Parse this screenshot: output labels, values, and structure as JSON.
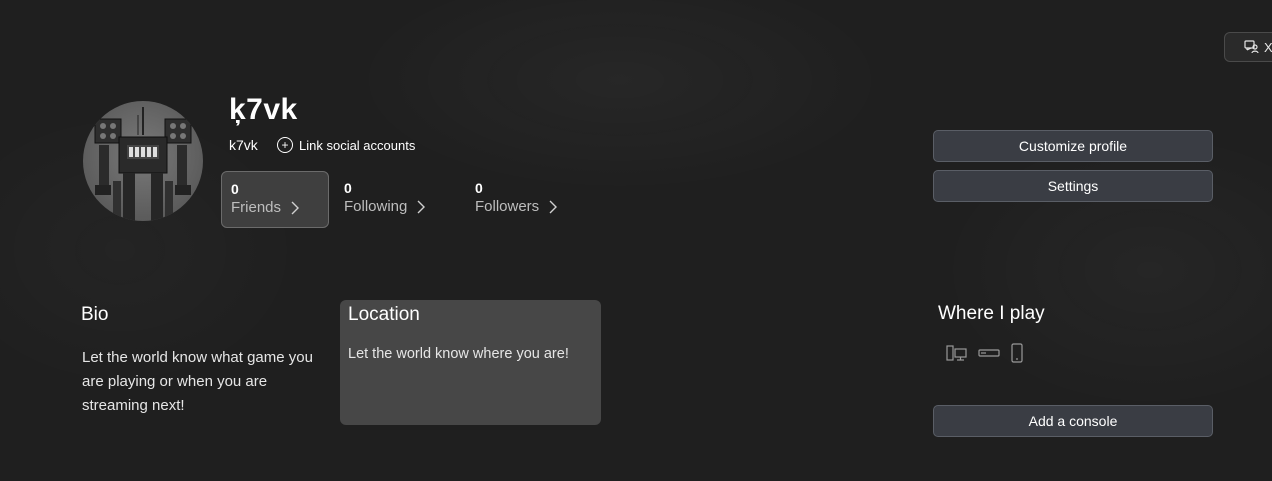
{
  "corner_chip": {
    "label": "X",
    "icon": "friends-icon"
  },
  "profile": {
    "gamertag": "ķ7vk",
    "subtag": "k7vk",
    "link_social_label": "Link social accounts",
    "avatar_icon": "robot-avatar"
  },
  "stats": [
    {
      "count": "0",
      "label": "Friends"
    },
    {
      "count": "0",
      "label": "Following"
    },
    {
      "count": "0",
      "label": "Followers"
    }
  ],
  "actions": {
    "customize_label": "Customize profile",
    "settings_label": "Settings",
    "add_console_label": "Add a console"
  },
  "bio": {
    "title": "Bio",
    "text": "Let the world know what game you are playing or when you are streaming next!"
  },
  "location": {
    "title": "Location",
    "text": "Let the world know where you are!"
  },
  "where_i_play": {
    "title": "Where I play",
    "icons": [
      "pc-icon",
      "console-icon",
      "mobile-icon"
    ]
  },
  "colors": {
    "background": "#1f1f1f",
    "button": "#3a3d44",
    "card": "#474747",
    "stat_active": "#3f3f3f"
  }
}
